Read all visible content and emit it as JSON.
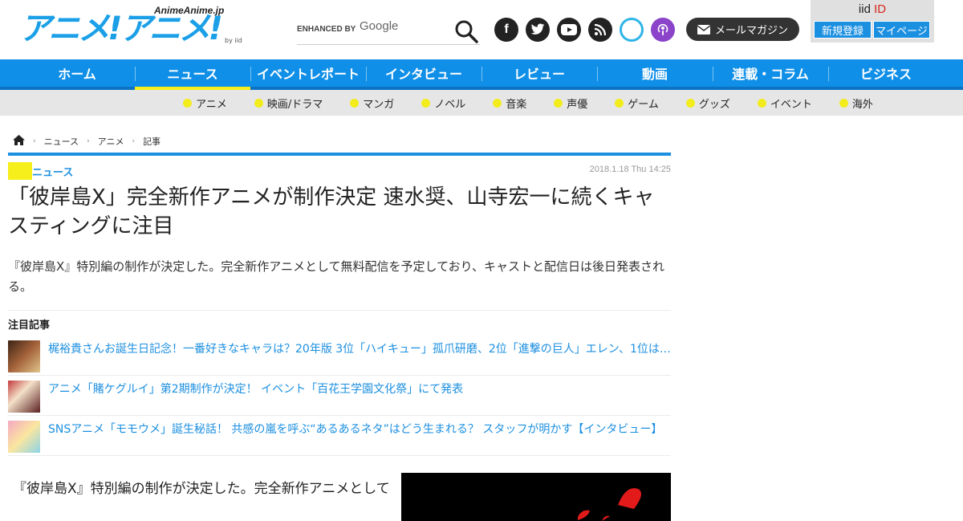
{
  "header": {
    "logo_sub": "AnimeAnime.jp",
    "logo_main": "アニメ!アニメ!",
    "logo_iid": "by iid",
    "search_placeholder": "ENHANCED BY",
    "search_google": "Google",
    "mail_label": "メールマガジン",
    "iid_title_prefix": "iid",
    "iid_title_suffix": "ID",
    "register_label": "新規登録",
    "mypage_label": "マイページ"
  },
  "social": [
    {
      "name": "facebook-icon",
      "glyph": "f"
    },
    {
      "name": "twitter-icon",
      "glyph": "🐦"
    },
    {
      "name": "youtube-icon",
      "glyph": "▶"
    },
    {
      "name": "rss-icon",
      "glyph": "⌇"
    },
    {
      "name": "alexa-icon",
      "glyph": ""
    },
    {
      "name": "podcast-icon",
      "glyph": "◉"
    }
  ],
  "mainnav": [
    "ホーム",
    "ニュース",
    "イベントレポート",
    "インタビュー",
    "レビュー",
    "動画",
    "連載・コラム",
    "ビジネス"
  ],
  "mainnav_active": 1,
  "subnav": [
    "アニメ",
    "映画/ドラマ",
    "マンガ",
    "ノベル",
    "音楽",
    "声優",
    "ゲーム",
    "グッズ",
    "イベント",
    "海外"
  ],
  "breadcrumb": [
    "ニュース",
    "アニメ",
    "記事"
  ],
  "article": {
    "category": "ニュース",
    "date": "2018.1.18 Thu 14:25",
    "title": "「彼岸島X」完全新作アニメが制作決定 速水奨、山寺宏一に続くキャスティングに注目",
    "lead": "『彼岸島X』特別編の制作が決定した。完全新作アニメとして無料配信を予定しており、キャストと配信日は後日発表される。",
    "featured_heading": "注目記事",
    "body_start": "『彼岸島X』特別編の制作が決定した。完全新作アニメとして"
  },
  "featured": [
    {
      "title": "梶裕貴さんお誕生日記念！一番好きなキャラは？20年版 3位「ハイキュー」孤爪研磨、2位「進撃の巨人」エレン、1位は…",
      "thumb_color": "#7a4a2c"
    },
    {
      "title": "アニメ「賭ケグルイ」第2期制作が決定！ イベント「百花王学園文化祭」にて発表",
      "thumb_color": "#a8323a"
    },
    {
      "title": "SNSアニメ「モモウメ」誕生秘話！ 共感の嵐を呼ぶ“あるあるネタ”はどう生まれる？ スタッフが明かす【インタビュー】",
      "thumb_color": "#e57fa3"
    }
  ],
  "colors": {
    "brand_blue": "#1b8fe0",
    "accent_yellow": "#f6ef1c"
  }
}
